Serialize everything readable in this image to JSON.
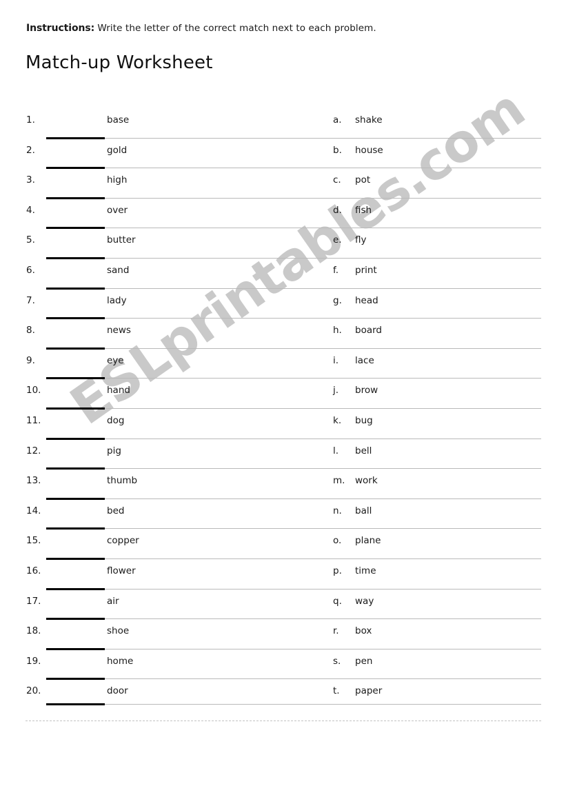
{
  "header": {
    "instructions_label": "Instructions:",
    "instructions_text": "Write the letter of the correct match next to each problem.",
    "title": "Match-up Worksheet"
  },
  "watermark": {
    "text": "ESLprintables.com",
    "color": "#c9c9c9"
  },
  "colors": {
    "text": "#1a1a1a",
    "rule": "#b9b9b9",
    "blank": "#000000",
    "footer_divider": "#c2c2c2",
    "page_background": "#ffffff"
  },
  "worksheet": {
    "problems": [
      {
        "number": "1.",
        "word": "base"
      },
      {
        "number": "2.",
        "word": "gold"
      },
      {
        "number": "3.",
        "word": "high"
      },
      {
        "number": "4.",
        "word": "over"
      },
      {
        "number": "5.",
        "word": "butter"
      },
      {
        "number": "6.",
        "word": "sand"
      },
      {
        "number": "7.",
        "word": "lady"
      },
      {
        "number": "8.",
        "word": "news"
      },
      {
        "number": "9.",
        "word": "eye"
      },
      {
        "number": "10.",
        "word": "hand"
      },
      {
        "number": "11.",
        "word": "dog"
      },
      {
        "number": "12.",
        "word": "pig"
      },
      {
        "number": "13.",
        "word": "thumb"
      },
      {
        "number": "14.",
        "word": "bed"
      },
      {
        "number": "15.",
        "word": "copper"
      },
      {
        "number": "16.",
        "word": "flower"
      },
      {
        "number": "17.",
        "word": "air"
      },
      {
        "number": "18.",
        "word": "shoe"
      },
      {
        "number": "19.",
        "word": "home"
      },
      {
        "number": "20.",
        "word": "door"
      }
    ],
    "choices": [
      {
        "letter": "a.",
        "word": "shake"
      },
      {
        "letter": "b.",
        "word": "house"
      },
      {
        "letter": "c.",
        "word": "pot"
      },
      {
        "letter": "d.",
        "word": "fish"
      },
      {
        "letter": "e.",
        "word": "fly"
      },
      {
        "letter": "f.",
        "word": "print"
      },
      {
        "letter": "g.",
        "word": "head"
      },
      {
        "letter": "h.",
        "word": "board"
      },
      {
        "letter": "i.",
        "word": "lace"
      },
      {
        "letter": "j.",
        "word": "brow"
      },
      {
        "letter": "k.",
        "word": "bug"
      },
      {
        "letter": "l.",
        "word": "bell"
      },
      {
        "letter": "m.",
        "word": "work"
      },
      {
        "letter": "n.",
        "word": "ball"
      },
      {
        "letter": "o.",
        "word": "plane"
      },
      {
        "letter": "p.",
        "word": "time"
      },
      {
        "letter": "q.",
        "word": "way"
      },
      {
        "letter": "r.",
        "word": "box"
      },
      {
        "letter": "s.",
        "word": "pen"
      },
      {
        "letter": "t.",
        "word": "paper"
      }
    ]
  }
}
